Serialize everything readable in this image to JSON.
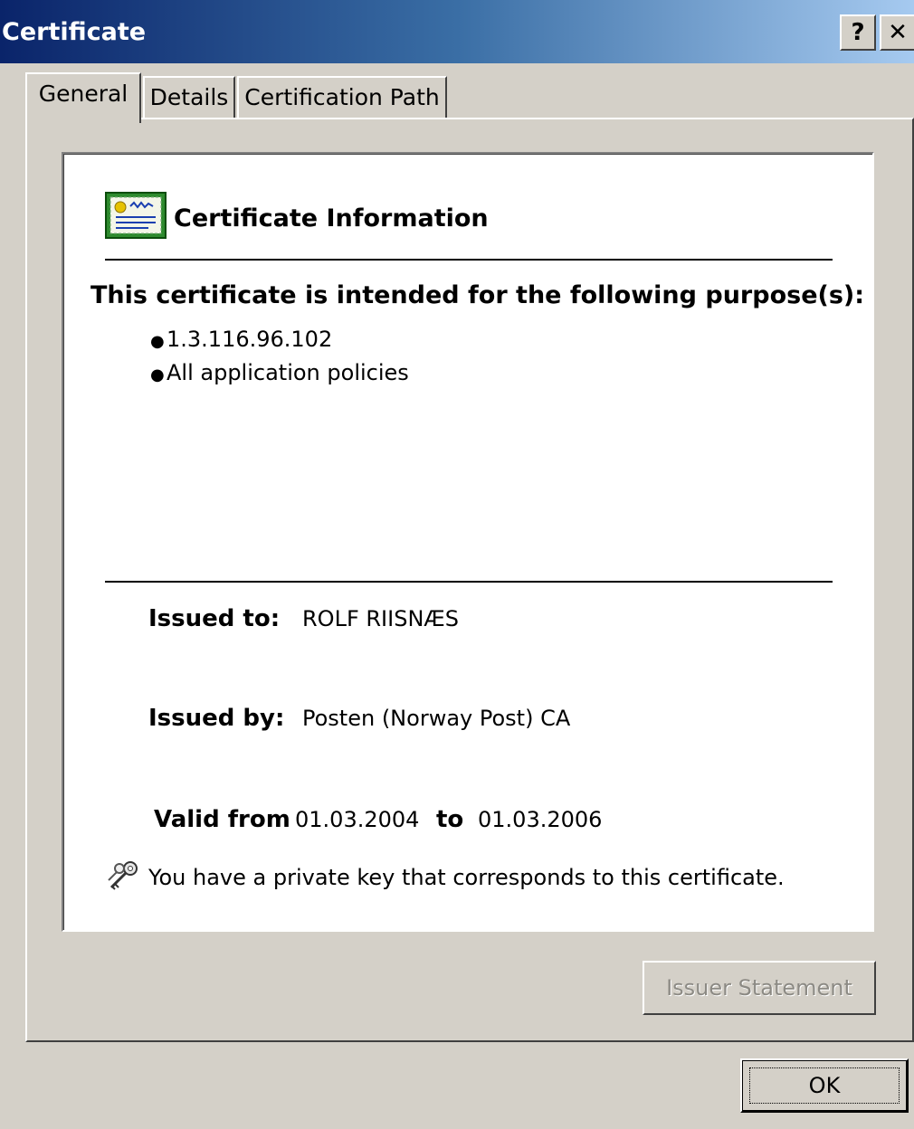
{
  "window": {
    "title": "Certificate",
    "help_label": "?",
    "close_label": "✕"
  },
  "tabs": [
    {
      "label": "General",
      "active": true
    },
    {
      "label": "Details",
      "active": false
    },
    {
      "label": "Certification Path",
      "active": false
    }
  ],
  "info": {
    "title": "Certificate Information",
    "purpose_heading": "This certificate is intended for the following purpose(s):",
    "purposes": [
      "1.3.116.96.102",
      "All application policies"
    ],
    "issued_to_label": "Issued to:",
    "issued_to": "ROLF RIISNÆS",
    "issued_by_label": "Issued by:",
    "issued_by": "Posten (Norway Post) CA",
    "valid_from_label": "Valid from",
    "valid_from": "01.03.2004",
    "to_label": "to",
    "valid_to": "01.03.2006",
    "key_note": "You have a private key that corresponds to this certificate."
  },
  "buttons": {
    "issuer_statement": "Issuer Statement",
    "ok": "OK"
  },
  "icons": {
    "certificate": "certificate-icon",
    "key": "key-icon"
  }
}
